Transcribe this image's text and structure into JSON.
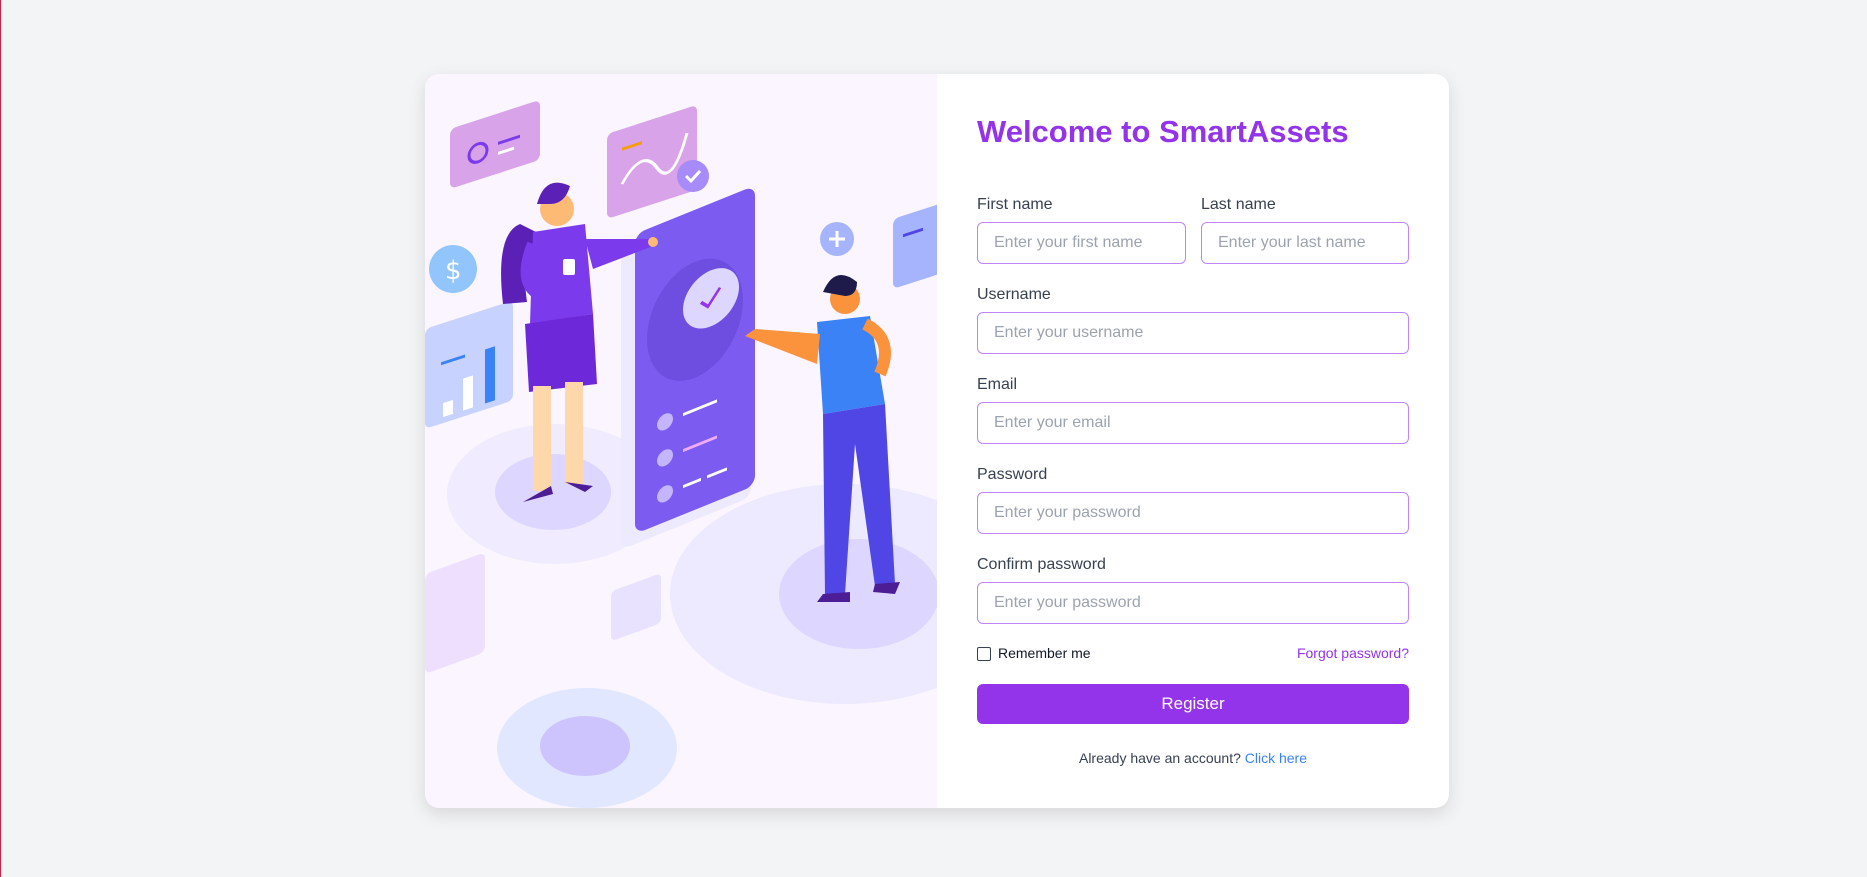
{
  "form": {
    "title": "Welcome to SmartAssets",
    "first_name": {
      "label": "First name",
      "placeholder": "Enter your first name"
    },
    "last_name": {
      "label": "Last name",
      "placeholder": "Enter your last name"
    },
    "username": {
      "label": "Username",
      "placeholder": "Enter your username"
    },
    "email": {
      "label": "Email",
      "placeholder": "Enter your email"
    },
    "password": {
      "label": "Password",
      "placeholder": "Enter your password"
    },
    "confirm_password": {
      "label": "Confirm password",
      "placeholder": "Enter your password"
    },
    "remember_label": "Remember me",
    "remember_checked": false,
    "forgot_label": "Forgot password?",
    "register_label": "Register",
    "already_text": "Already have an account?",
    "login_link": "Click here"
  },
  "colors": {
    "accent": "#9333ea",
    "link": "#3b82f6",
    "illustration_bg": "#faf5ff",
    "page_bg": "#f3f4f6"
  },
  "icons": [
    "dollar-icon",
    "plus-icon",
    "check-icon",
    "chart-icon"
  ]
}
